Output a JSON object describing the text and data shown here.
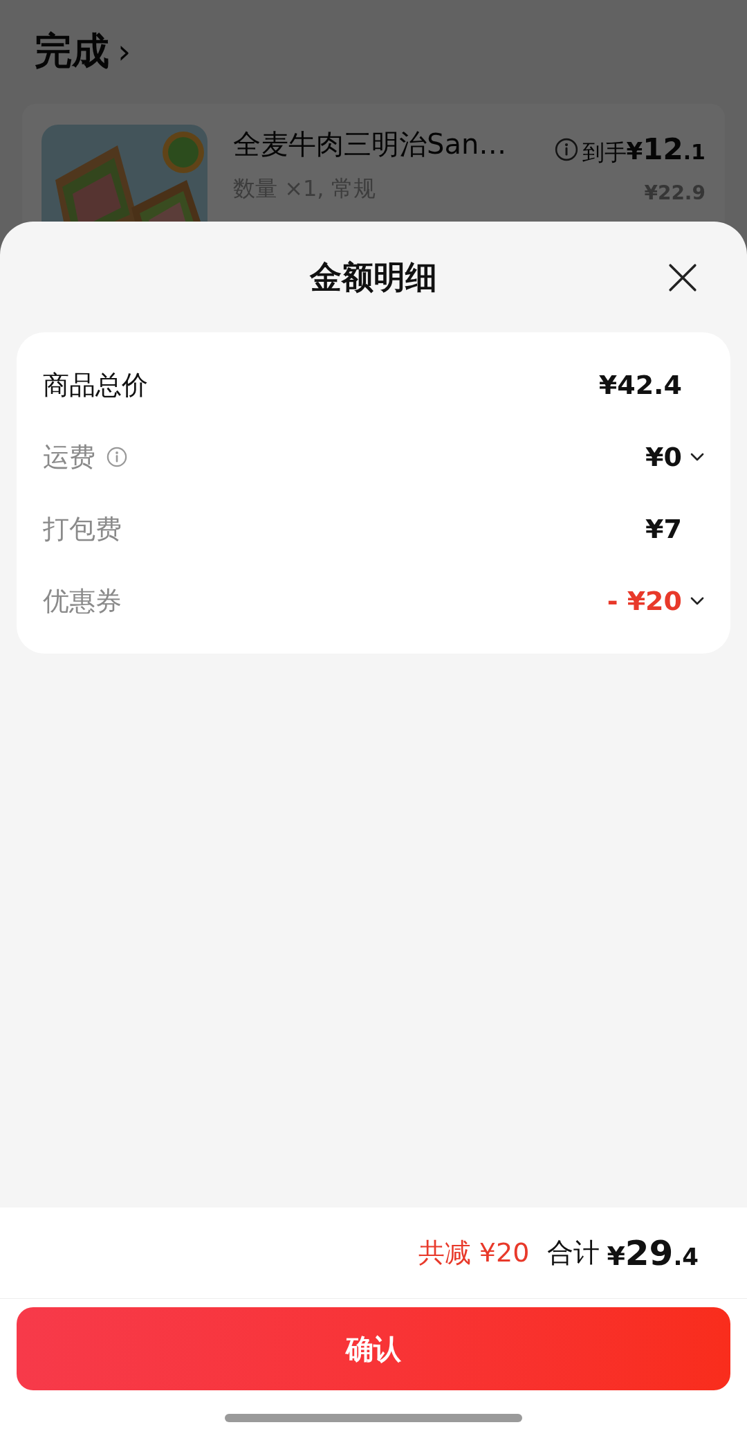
{
  "background": {
    "status_link": "完成",
    "chevron": "›",
    "item": {
      "name": "全麦牛肉三明治San…",
      "spec": "数量 ×1, 常规",
      "final_label": "到手",
      "final_price": "¥12.1",
      "original_price": "¥22.9"
    }
  },
  "sheet": {
    "title": "金额明细",
    "rows": [
      {
        "kind": "total",
        "label": "商品总价",
        "value": "¥42.4",
        "info": false,
        "expandable": false
      },
      {
        "kind": "fee",
        "label": "运费",
        "value": "¥0",
        "info": true,
        "expandable": true
      },
      {
        "kind": "fee",
        "label": "打包费",
        "value": "¥7",
        "info": false,
        "expandable": false
      },
      {
        "kind": "discount",
        "label": "优惠券",
        "value": "- ¥20",
        "info": false,
        "expandable": true
      }
    ],
    "savings": "共减 ¥20",
    "total_label": "合计",
    "total": "¥29.4",
    "confirm": "确认"
  }
}
